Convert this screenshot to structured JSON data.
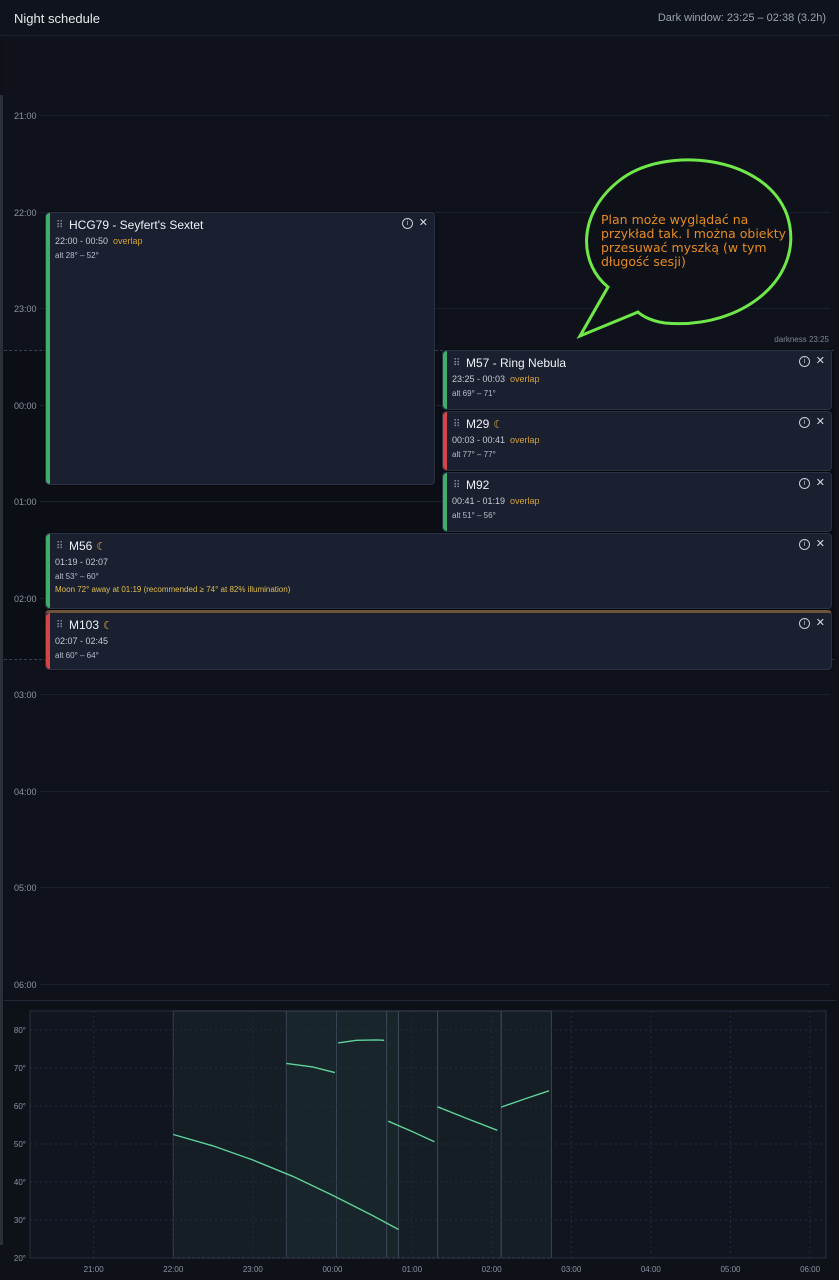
{
  "header": {
    "title": "Night schedule",
    "dark_window": "Dark window: 23:25 – 02:38 (3.2h)"
  },
  "timeline": {
    "hour_labels": [
      "21:00",
      "22:00",
      "23:00",
      "00:00",
      "01:00",
      "02:00",
      "03:00",
      "04:00",
      "05:00",
      "06:00"
    ],
    "darkness_label": "darkness 23:25"
  },
  "annotation": {
    "text": "Plan może wyglądać na przykład tak. I można obiekty przesuwać myszką (w tym długość sesji)"
  },
  "cards": [
    {
      "name": "HCG79 - Seyfert's Sextet",
      "moon": false,
      "times": "22:00 - 00:50",
      "overlap": "overlap",
      "alt": "alt 28° – 52°",
      "warning": "",
      "stripe": "#3fae6a"
    },
    {
      "name": "M57 - Ring Nebula",
      "moon": false,
      "times": "23:25 - 00:03",
      "overlap": "overlap",
      "alt": "alt 69° – 71°",
      "warning": "",
      "stripe": "#3fae6a"
    },
    {
      "name": "M29",
      "moon": true,
      "times": "00:03 - 00:41",
      "overlap": "overlap",
      "alt": "alt 77° – 77°",
      "warning": "",
      "stripe": "#d64545"
    },
    {
      "name": "M92",
      "moon": false,
      "times": "00:41 - 01:19",
      "overlap": "overlap",
      "alt": "alt 51° – 56°",
      "warning": "",
      "stripe": "#3fae6a"
    },
    {
      "name": "M56",
      "moon": true,
      "times": "01:19 - 02:07",
      "overlap": "",
      "alt": "alt 53° – 60°",
      "warning": "Moon 72° away at 01:19 (recommended ≥ 74° at 82% illumination)",
      "stripe": "#3fae6a"
    },
    {
      "name": "M103",
      "moon": true,
      "times": "02:07 - 02:45",
      "overlap": "",
      "alt": "alt 60° – 64°",
      "warning": "",
      "stripe": "#d64545"
    }
  ],
  "icons": {
    "grip": "grip-icon",
    "info": "info-icon",
    "close": "close-icon",
    "moon": "moon-icon"
  },
  "colors": {
    "accent_green": "#3fae6a",
    "accent_red": "#d64545",
    "overlap": "#d6a034",
    "curve": "#5fd39a",
    "bubble": "#6fe84a"
  },
  "chart_data": {
    "type": "line",
    "x_ticks": [
      "21:00",
      "22:00",
      "23:00",
      "00:00",
      "01:00",
      "02:00",
      "03:00",
      "04:00",
      "05:00",
      "06:00"
    ],
    "y_ticks": [
      "20°",
      "30°",
      "40°",
      "50°",
      "60°",
      "70°",
      "80°"
    ],
    "ylim": [
      20,
      85
    ],
    "xlim_hours": [
      20.2,
      30.2
    ],
    "grid": true,
    "sessions": [
      {
        "start": 22.0,
        "end": 24.83
      },
      {
        "start": 23.42,
        "end": 24.05
      },
      {
        "start": 24.05,
        "end": 24.68
      },
      {
        "start": 24.68,
        "end": 25.32
      },
      {
        "start": 25.32,
        "end": 26.12
      },
      {
        "start": 26.12,
        "end": 26.75
      }
    ],
    "series": [
      {
        "x": [
          22.0,
          22.5,
          23.0,
          23.5,
          24.0,
          24.5,
          24.83
        ],
        "y": [
          52.5,
          49.5,
          45.8,
          41.5,
          36.5,
          31.2,
          27.5
        ]
      },
      {
        "x": [
          23.42,
          23.75,
          24.03
        ],
        "y": [
          71.2,
          70.3,
          68.8
        ]
      },
      {
        "x": [
          24.07,
          24.3,
          24.55,
          24.65
        ],
        "y": [
          76.6,
          77.3,
          77.4,
          77.3
        ]
      },
      {
        "x": [
          24.7,
          25.0,
          25.28
        ],
        "y": [
          56.0,
          53.3,
          50.6
        ]
      },
      {
        "x": [
          25.32,
          25.7,
          26.07
        ],
        "y": [
          59.8,
          56.6,
          53.6
        ]
      },
      {
        "x": [
          26.12,
          26.45,
          26.72
        ],
        "y": [
          59.7,
          62.1,
          64.0
        ]
      }
    ]
  }
}
